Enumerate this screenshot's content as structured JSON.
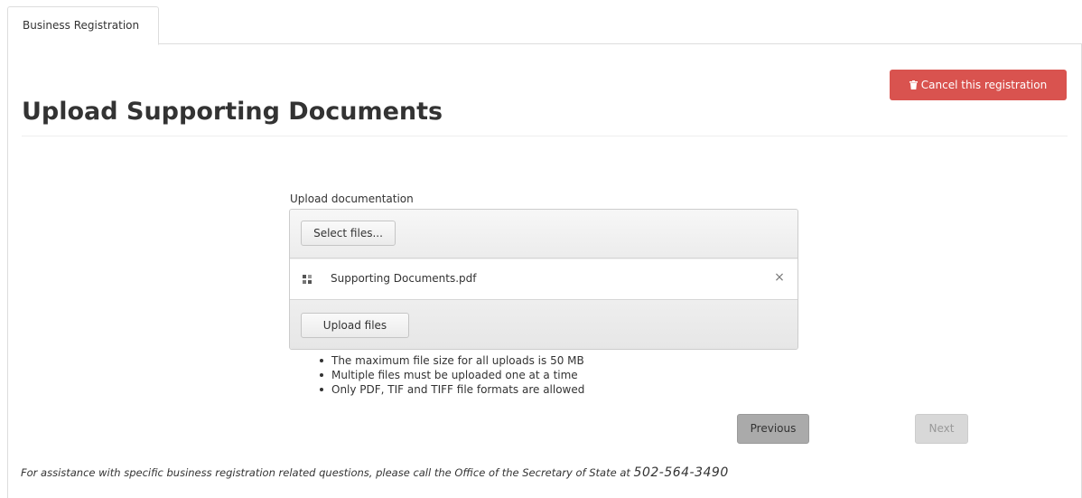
{
  "tabs": [
    {
      "label": "Business Registration"
    }
  ],
  "header": {
    "cancel_label": "Cancel this registration",
    "cancel_icon": "trash-icon",
    "title": "Upload Supporting Documents"
  },
  "upload": {
    "label": "Upload documentation",
    "select_label": "Select files...",
    "files": [
      {
        "name": "Supporting Documents.pdf",
        "icon": "file-icon",
        "remove": "×"
      }
    ],
    "upload_label": "Upload files"
  },
  "notes": [
    "The maximum file size for all uploads is 50 MB",
    "Multiple files must be uploaded one at a time",
    "Only PDF, TIF and TIFF file formats are allowed"
  ],
  "nav": {
    "previous_label": "Previous",
    "next_label": "Next"
  },
  "footer": {
    "assistance_text": "For assistance with specific business registration related questions, please call the Office of the Secretary of State at",
    "phone": "502-564-3490"
  },
  "colors": {
    "danger": "#d9534f",
    "border": "#dddddd",
    "text": "#333333"
  }
}
